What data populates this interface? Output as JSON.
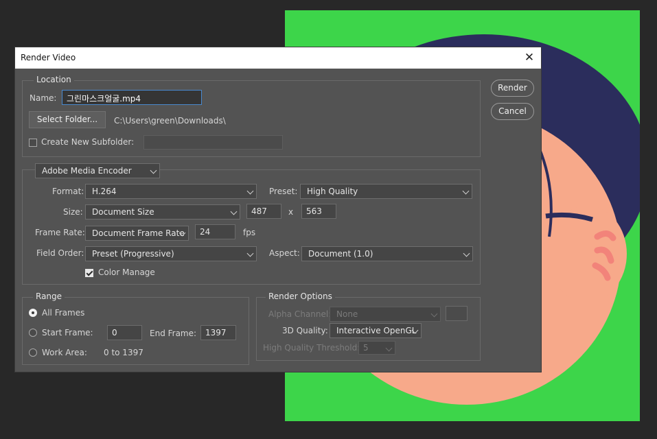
{
  "dialog": {
    "title": "Render Video",
    "close_icon": "close-icon"
  },
  "location": {
    "legend": "Location",
    "name_label": "Name:",
    "name_value": "그린마스크얼굴.mp4",
    "select_folder_button": "Select Folder...",
    "folder_path": "C:\\Users\\green\\Downloads\\",
    "subfolder_checkbox_label": "Create New Subfolder:",
    "subfolder_checked": false,
    "subfolder_value": ""
  },
  "encoder": {
    "selector_value": "Adobe Media Encoder",
    "format_label": "Format:",
    "format_value": "H.264",
    "preset_label": "Preset:",
    "preset_value": "High Quality",
    "size_label": "Size:",
    "size_value": "Document Size",
    "width_value": "487",
    "times_sign": "x",
    "height_value": "563",
    "frame_rate_label": "Frame Rate:",
    "frame_rate_value": "Document Frame Rate",
    "fps_value": "24",
    "fps_unit": "fps",
    "field_order_label": "Field Order:",
    "field_order_value": "Preset (Progressive)",
    "aspect_label": "Aspect:",
    "aspect_value": "Document (1.0)",
    "color_manage_label": "Color Manage",
    "color_manage_checked": true
  },
  "range": {
    "legend": "Range",
    "all_frames_label": "All Frames",
    "all_frames_selected": true,
    "start_frame_label": "Start Frame:",
    "start_frame_value": "0",
    "end_frame_label": "End Frame:",
    "end_frame_value": "1397",
    "work_area_label": "Work Area:",
    "work_area_value": "0 to 1397"
  },
  "render_options": {
    "legend": "Render Options",
    "alpha_channel_label": "Alpha Channel:",
    "alpha_channel_value": "None",
    "quality_3d_label": "3D Quality:",
    "quality_3d_value": "Interactive OpenGL",
    "hq_threshold_label": "High Quality Threshold:",
    "hq_threshold_value": "5"
  },
  "buttons": {
    "render": "Render",
    "cancel": "Cancel"
  },
  "colors": {
    "canvas_green": "#3dd54a",
    "dialog_bg": "#535353",
    "hair": "#2b2d5c",
    "skin": "#f7a98a",
    "glasses": "#2b2d5c",
    "focus_border": "#4a8ad0"
  }
}
